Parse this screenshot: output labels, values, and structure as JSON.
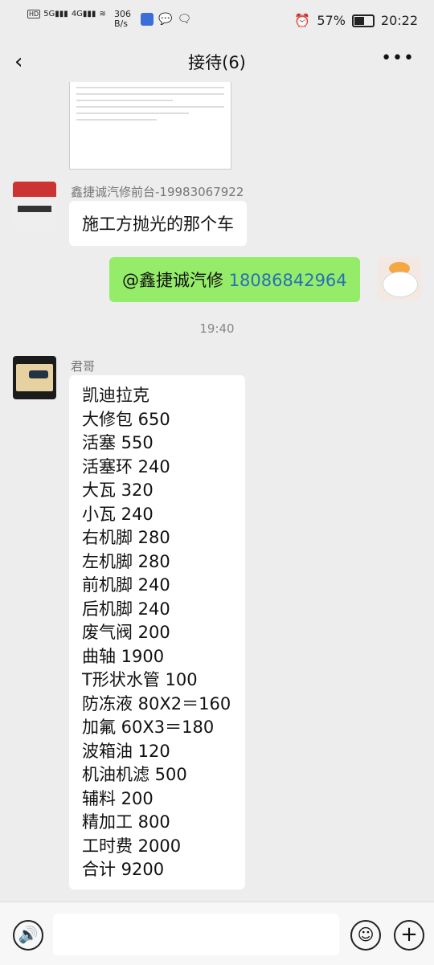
{
  "status_bar": {
    "net_speed": "306",
    "net_unit": "B/s",
    "battery": "57%",
    "time": "20:22"
  },
  "nav": {
    "title": "接待(6)"
  },
  "messages": [
    {
      "sender": "鑫捷诚汽修前台-19983067922",
      "text": "施工方抛光的那个车"
    },
    {
      "mention_name": "@鑫捷诚汽修",
      "mention_phone": "18086842964"
    }
  ],
  "timestamp": "19:40",
  "list_message": {
    "sender": "君哥",
    "lines": [
      "凯迪拉克",
      "大修包 650",
      "活塞 550",
      "活塞环 240",
      "大瓦 320",
      "小瓦 240",
      "右机脚 280",
      "左机脚 280",
      "前机脚 240",
      "后机脚 240",
      "废气阀 200",
      "曲轴 1900",
      "T形状水管 100",
      "防冻液 80X2＝160",
      "加氟 60X3＝180",
      "波箱油 120",
      "机油机滤 500",
      "辅料 200",
      "精加工 800",
      "工时费 2000",
      "合计 9200"
    ]
  },
  "icons": {
    "back": "back-arrow-icon",
    "more": "more-icon",
    "voice": "voice-icon",
    "emoji": "emoji-icon",
    "plus": "plus-icon"
  }
}
